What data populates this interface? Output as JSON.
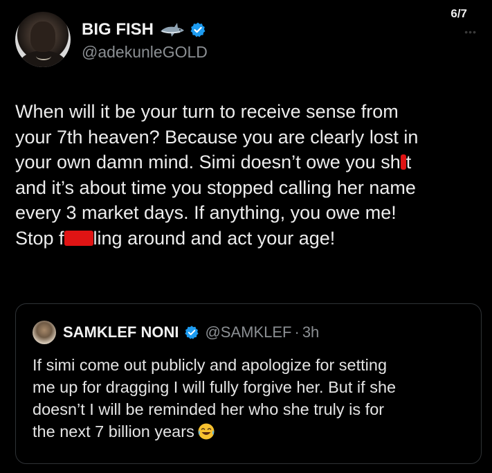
{
  "page_counter": "6/7",
  "author": {
    "display_name": "BIG FISH",
    "handle": "@adekunleGOLD",
    "badge_icon": "shark-emoji-icon",
    "verified_color": "#1d9bf0"
  },
  "tweet": {
    "lines": [
      "When will it be your turn to receive sense from",
      "your 7th heaven? Because you are clearly lost in",
      "your own damn mind. Simi doesn’t owe you sh",
      "and it’s about time you stopped calling her name",
      "every 3 market days. If anything, you owe me!",
      "Stop f"
    ],
    "line3_tail": "t",
    "line6_tail": "ling around and act your age!"
  },
  "quote": {
    "display_name": "SAMKLEF NONI",
    "handle": "@SAMKLEF",
    "separator": "·",
    "time": "3h",
    "lines": [
      "If simi come out publicly and apologize for setting",
      "me up for dragging I will fully forgive her. But if she",
      "doesn’t I will be reminded her who she truly is for",
      "the next 7 billion years"
    ],
    "trailing_emoji": "face-with-tears-of-joy-icon"
  },
  "colors": {
    "background": "#000000",
    "text": "#e7e9ea",
    "secondary_text": "#8b8f93",
    "redaction": "#e01414",
    "border": "#2f3336"
  }
}
